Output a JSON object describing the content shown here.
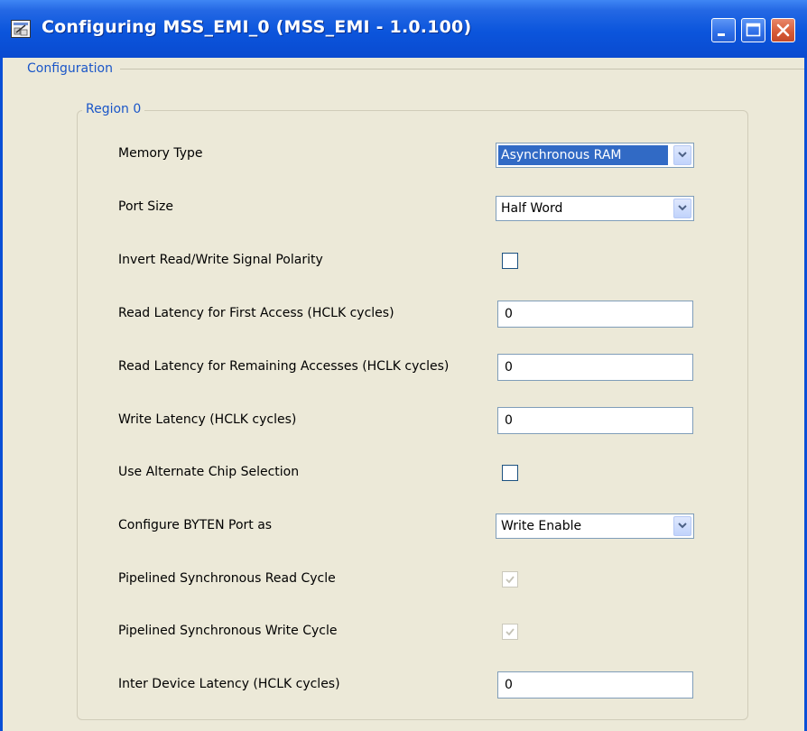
{
  "window": {
    "title": "Configuring MSS_EMI_0 (MSS_EMI - 1.0.100)",
    "icon": "app-icon",
    "controls": [
      "minimize-icon",
      "maximize-icon",
      "close-icon"
    ],
    "colors": {
      "titlebar": "#0b55dc",
      "client": "#ece9d8",
      "group_text": "#1a56c8",
      "selection": "#316ac5"
    }
  },
  "configuration": {
    "group_label": "Configuration",
    "region": {
      "group_label": "Region 0",
      "fields": [
        {
          "label": "Memory Type",
          "control": "dropdown",
          "value": "Asynchronous RAM"
        },
        {
          "label": "Port Size",
          "control": "dropdown",
          "value": "Half Word"
        },
        {
          "label": "Invert Read/Write Signal Polarity",
          "control": "checkbox",
          "checked": false
        },
        {
          "label": "Read Latency for First Access (HCLK cycles)",
          "control": "text",
          "value": "0"
        },
        {
          "label": "Read Latency for Remaining Accesses (HCLK cycles)",
          "control": "text",
          "value": "0"
        },
        {
          "label": "Write Latency (HCLK cycles)",
          "control": "text",
          "value": "0"
        },
        {
          "label": "Use Alternate Chip Selection",
          "control": "checkbox",
          "checked": false
        },
        {
          "label": "Configure BYTEN Port as",
          "control": "dropdown",
          "value": "Write Enable"
        },
        {
          "label": "Pipelined Synchronous Read Cycle",
          "control": "checkbox",
          "checked": true,
          "disabled": true
        },
        {
          "label": "Pipelined Synchronous Write Cycle",
          "control": "checkbox",
          "checked": true,
          "disabled": true
        },
        {
          "label": "Inter Device Latency (HCLK cycles)",
          "control": "text",
          "value": "0"
        }
      ]
    }
  }
}
